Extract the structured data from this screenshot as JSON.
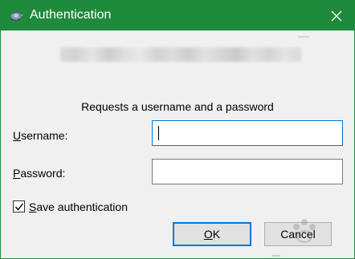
{
  "window": {
    "title": "Authentication",
    "close_icon": "close-icon",
    "app_icon": "tortoise-icon",
    "accent_color": "#1e8a3c"
  },
  "dialog": {
    "prompt": "Requests a username and a password",
    "username": {
      "label_accel": "U",
      "label_rest": "sername:",
      "value": ""
    },
    "password": {
      "label_accel": "P",
      "label_rest": "assword:",
      "value": ""
    },
    "save_auth": {
      "checked": true,
      "label_accel": "S",
      "label_rest": "ave authentication"
    },
    "buttons": {
      "ok_accel": "O",
      "ok_rest": "K",
      "cancel": "Cancel"
    }
  }
}
